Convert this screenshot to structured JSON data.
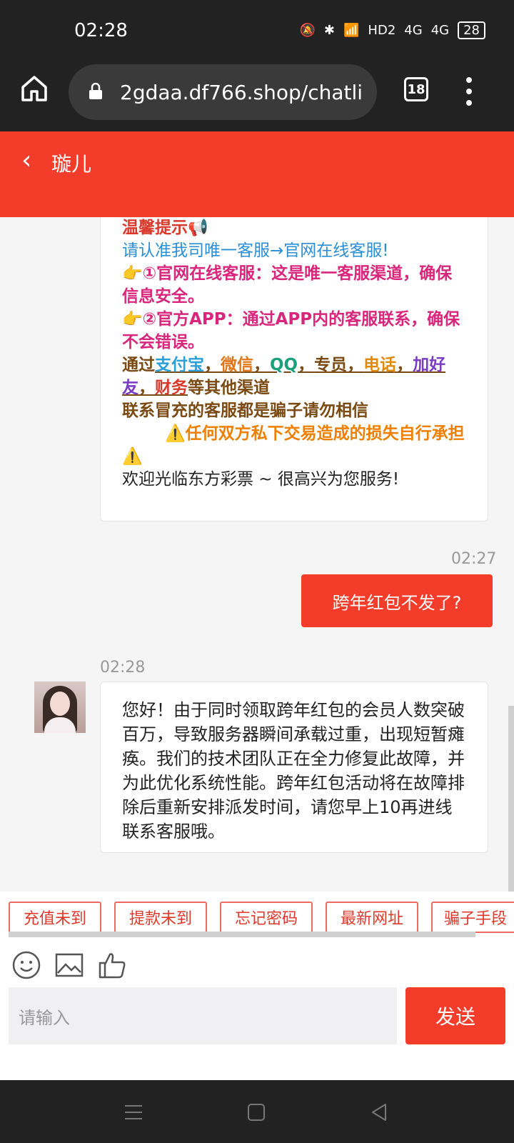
{
  "status_bar": {
    "time": "02:28",
    "battery": "28",
    "network1": "4G",
    "network2": "4G",
    "hd": "HD2"
  },
  "browser": {
    "url": "2gdaa.df766.shop/chatli",
    "tab_count": "18"
  },
  "header": {
    "title": "璇儿"
  },
  "welcome_message": {
    "title": "温馨提示📢",
    "line1": "请认准我司唯一客服→官网在线客服!",
    "line2": "👉①官网在线客服：这是唯一客服渠道，确保信息安全。",
    "line3": "👉②官方APP：通过APP内的客服联系，确保不会错误。",
    "channels_prefix": "通过",
    "channels": [
      "支付宝",
      "微信",
      "QQ",
      "专员",
      "电话",
      "加好友",
      "财务"
    ],
    "channels_suffix": "等其他渠道",
    "warning1": "联系冒充的客服都是骗子请勿相信",
    "warning2": "⚠️任何双方私下交易造成的损失自行承担⚠️",
    "greeting": "欢迎光临东方彩票 ~ 很高兴为您服务!"
  },
  "messages": [
    {
      "time": "02:27",
      "text": "跨年红包不发了?"
    },
    {
      "time": "02:28",
      "text": "您好！由于同时领取跨年红包的会员人数突破百万，导致服务器瞬间承载过重，出现短暂瘫痪。我们的技术团队正在全力修复此故障，并为此优化系统性能。跨年红包活动将在故障排除后重新安排派发时间，请您早上10再进线联系客服哦。"
    }
  ],
  "quick_replies": [
    "充值未到",
    "提款未到",
    "忘记密码",
    "最新网址",
    "骗子手段"
  ],
  "composer": {
    "placeholder": "请输入",
    "send_label": "发送"
  },
  "icons": [
    "home-icon",
    "lock-icon",
    "menu-icon",
    "emoji-icon",
    "image-icon",
    "thumbs-up-icon",
    "back-icon"
  ]
}
